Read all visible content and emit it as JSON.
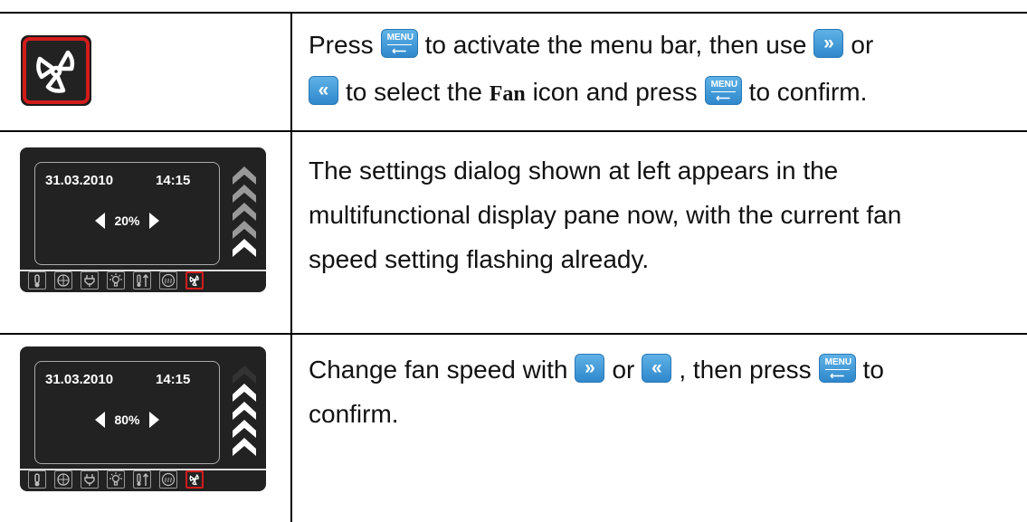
{
  "rows": [
    {
      "parts": [
        "Press",
        "MENU",
        "to activate the menu bar, then use",
        "»",
        "or",
        "«",
        "to select the",
        "Fan",
        "icon and press",
        "MENU",
        "to confirm."
      ]
    },
    {
      "text": [
        "The settings dialog shown at left appears in the",
        "multifunctional display pane now, with the current fan",
        "speed setting flashing already."
      ],
      "display": {
        "date": "31.03.2010",
        "time": "14:15",
        "percent": "20%",
        "level": 1
      }
    },
    {
      "parts": [
        "Change fan speed with",
        "»",
        "or",
        "«",
        ", then press",
        "MENU",
        "to",
        "confirm."
      ],
      "display": {
        "date": "31.03.2010",
        "time": "14:15",
        "percent": "80%",
        "level": 4
      }
    }
  ],
  "buttons": {
    "menu": "MENU",
    "enter": "⟵",
    "next": "»",
    "prev": "«"
  },
  "iconbar": [
    "thermometer-icon",
    "target-icon",
    "plug-icon",
    "lightbulb-icon",
    "temperature-up-icon",
    "heat-wave-icon",
    "fan-icon"
  ],
  "colors": {
    "active": "#d21c1c",
    "button": "#3a95d6",
    "panel": "#222222"
  }
}
